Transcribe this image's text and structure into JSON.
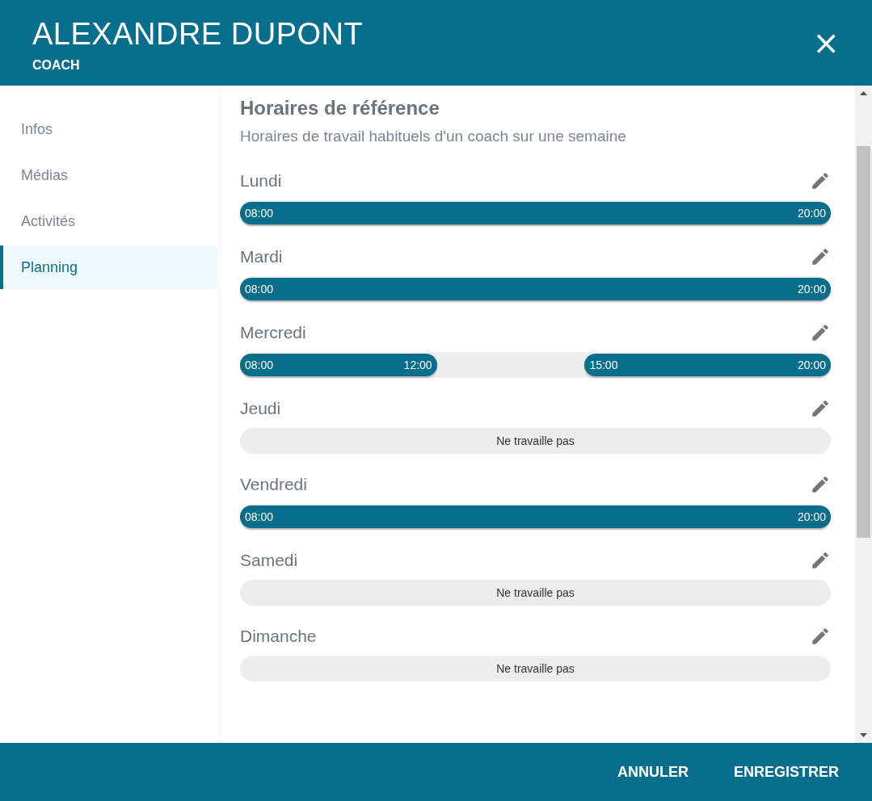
{
  "header": {
    "title": "ALEXANDRE DUPONT",
    "subtitle": "COACH",
    "close": "×"
  },
  "sidebar": {
    "items": [
      {
        "label": "Infos",
        "selected": false
      },
      {
        "label": "Médias",
        "selected": false
      },
      {
        "label": "Activités",
        "selected": false
      },
      {
        "label": "Planning",
        "selected": true
      }
    ]
  },
  "section": {
    "title": "Horaires de référence",
    "subtitle": "Horaires de travail habituels d'un coach sur une semaine"
  },
  "days": [
    {
      "name": "Lundi",
      "periods": [
        {
          "start": "08:00",
          "end": "20:00"
        }
      ]
    },
    {
      "name": "Mardi",
      "periods": [
        {
          "start": "08:00",
          "end": "20:00"
        }
      ]
    },
    {
      "name": "Mercredi",
      "periods": [
        {
          "start": "08:00",
          "end": "12:00"
        },
        {
          "start": "15:00",
          "end": "20:00"
        }
      ]
    },
    {
      "name": "Jeudi",
      "off_label": "Ne travaille pas"
    },
    {
      "name": "Vendredi",
      "periods": [
        {
          "start": "08:00",
          "end": "20:00"
        }
      ]
    },
    {
      "name": "Samedi",
      "off_label": "Ne travaille pas"
    },
    {
      "name": "Dimanche",
      "off_label": "Ne travaille pas"
    }
  ],
  "footer": {
    "buttons": [
      "ANNULER",
      "ENREGISTRER"
    ]
  }
}
